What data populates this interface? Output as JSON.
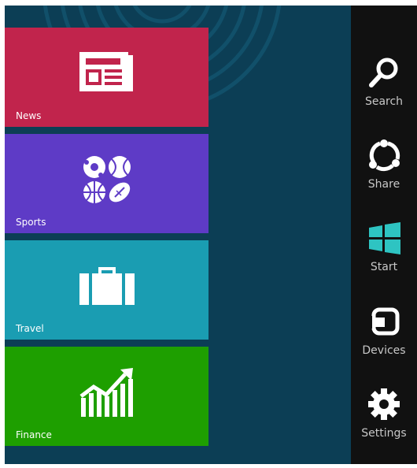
{
  "tiles": [
    {
      "label": "News",
      "color": "#c1244c",
      "icon": "newspaper-icon"
    },
    {
      "label": "Sports",
      "color": "#5e3bc6",
      "icon": "sports-balls-icon"
    },
    {
      "label": "Travel",
      "color": "#1a9db2",
      "icon": "suitcase-icon"
    },
    {
      "label": "Finance",
      "color": "#1e9f00",
      "icon": "stock-chart-icon"
    }
  ],
  "charms": [
    {
      "label": "Search",
      "icon": "search-icon"
    },
    {
      "label": "Share",
      "icon": "share-icon"
    },
    {
      "label": "Start",
      "icon": "windows-logo-icon"
    },
    {
      "label": "Devices",
      "icon": "devices-icon"
    },
    {
      "label": "Settings",
      "icon": "settings-gear-icon"
    }
  ],
  "colors": {
    "start_background": "#0c3e55",
    "charms_bar": "#111111",
    "charm_label": "#c8c8c8",
    "start_logo": "#2ec4c2"
  }
}
